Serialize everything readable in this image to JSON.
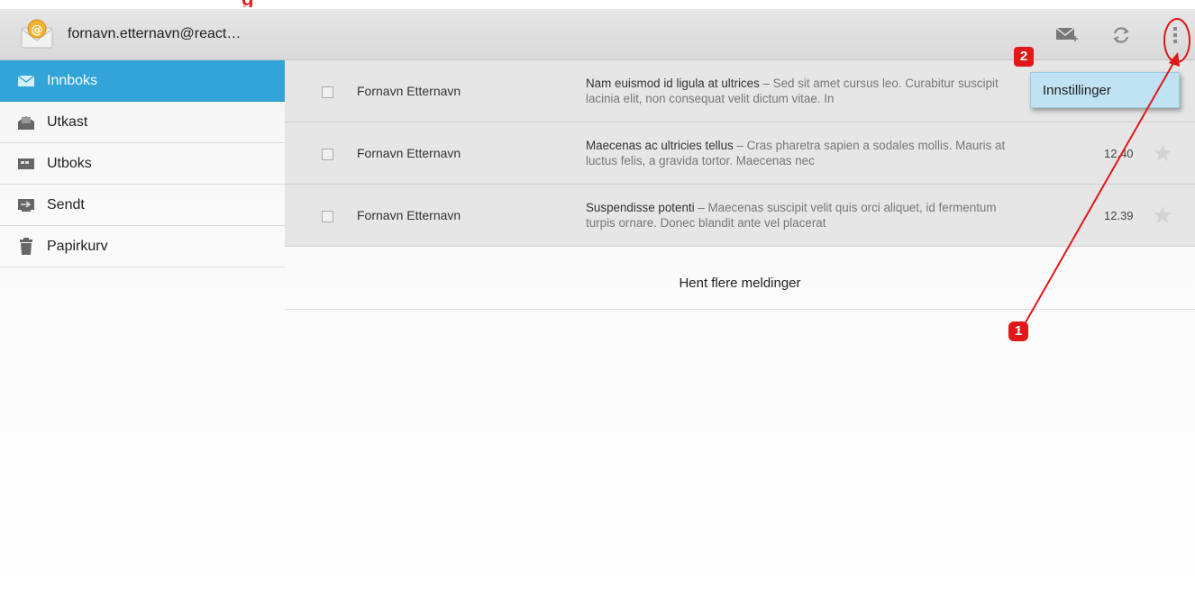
{
  "header": {
    "account": "fornavn.etternavn@react…"
  },
  "sidebar": {
    "items": [
      {
        "label": "Innboks",
        "icon": "inbox-icon",
        "active": true
      },
      {
        "label": "Utkast",
        "icon": "drafts-icon",
        "active": false
      },
      {
        "label": "Utboks",
        "icon": "outbox-icon",
        "active": false
      },
      {
        "label": "Sendt",
        "icon": "sent-icon",
        "active": false
      },
      {
        "label": "Papirkurv",
        "icon": "trash-icon",
        "active": false
      }
    ]
  },
  "messages": [
    {
      "sender": "Fornavn Etternavn",
      "subject": "Nam euismod id ligula at ultrices",
      "body": " – Sed sit amet cursus leo. Curabitur suscipit lacinia elit, non consequat velit dictum vitae. In",
      "time": ""
    },
    {
      "sender": "Fornavn Etternavn",
      "subject": "Maecenas ac ultricies tellus",
      "body": " – Cras pharetra sapien a sodales mollis. Mauris at luctus felis, a gravida tortor. Maecenas nec",
      "time": "12.40"
    },
    {
      "sender": "Fornavn Etternavn",
      "subject": "Suspendisse potenti",
      "body": " – Maecenas suscipit velit quis orci aliquet, id fermentum turpis ornare. Donec blandit ante vel placerat",
      "time": "12.39"
    }
  ],
  "load_more": "Hent flere meldinger",
  "menu": {
    "items": [
      "Innstillinger"
    ]
  },
  "annotations": {
    "badge1": "1",
    "badge2": "2"
  },
  "colors": {
    "accent": "#33a4d8",
    "annotation": "#e01818"
  }
}
